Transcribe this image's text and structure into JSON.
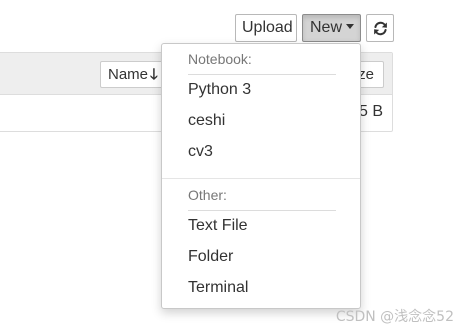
{
  "toolbar": {
    "upload_label": "Upload",
    "new_label": "New",
    "refresh_icon": "refresh-icon"
  },
  "list": {
    "sort_label": "Name",
    "sort_arrow": "🡓",
    "size_label_fragment": "ze",
    "row_size_fragment": "5 B"
  },
  "new_menu": {
    "notebook_header": "Notebook:",
    "notebook_items": [
      "Python 3",
      "ceshi",
      "cv3"
    ],
    "other_header": "Other:",
    "other_items": [
      "Text File",
      "Folder",
      "Terminal"
    ]
  },
  "watermark": "CSDN @浅念念52",
  "colors": {
    "active_button_bg": "#d4d4d4",
    "header_bg": "#eeeeee",
    "muted_text": "#777777"
  }
}
